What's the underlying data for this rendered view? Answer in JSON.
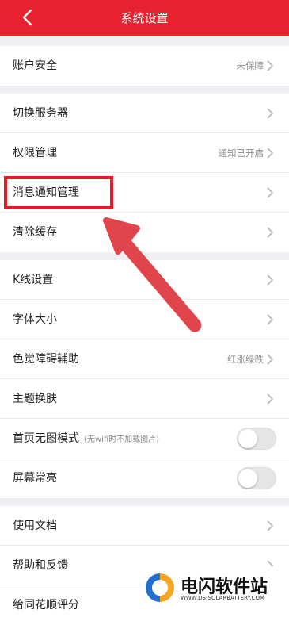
{
  "header": {
    "title": "系统设置",
    "background": "#e8222f"
  },
  "groups": [
    {
      "rows": [
        {
          "label": "账户安全",
          "value": "未保障"
        }
      ]
    },
    {
      "rows": [
        {
          "label": "切换服务器"
        },
        {
          "label": "权限管理",
          "value": "通知已开启"
        },
        {
          "label": "消息通知管理"
        },
        {
          "label": "清除缓存"
        }
      ]
    },
    {
      "rows": [
        {
          "label": "K线设置"
        },
        {
          "label": "字体大小"
        },
        {
          "label": "色觉障碍辅助",
          "value": "红涨绿跌"
        },
        {
          "label": "主题换肤"
        },
        {
          "label": "首页无图模式",
          "sub": "(无wifi时不加载图片)",
          "toggle": false
        },
        {
          "label": "屏幕常亮",
          "toggle": false
        }
      ]
    },
    {
      "rows": [
        {
          "label": "使用文档"
        },
        {
          "label": "帮助和反馈"
        },
        {
          "label": "给同花顺评分"
        }
      ]
    }
  ],
  "annotation": {
    "color": "#e21d2a"
  },
  "watermark": {
    "name": "电闪软件站",
    "url": "WWW.DS-SOLARBATTERY.COM"
  }
}
